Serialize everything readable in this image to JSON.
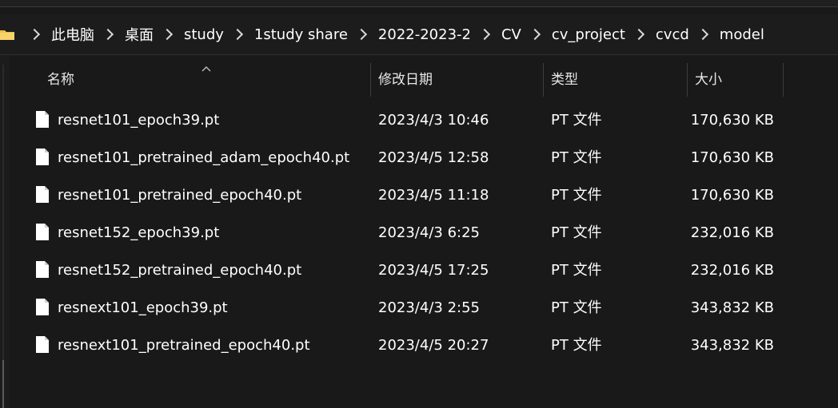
{
  "breadcrumb": {
    "items": [
      "此电脑",
      "桌面",
      "study",
      "1study share",
      "2022-2023-2",
      "CV",
      "cv_project",
      "cvcd",
      "model"
    ]
  },
  "columns": {
    "name": "名称",
    "date": "修改日期",
    "type": "类型",
    "size": "大小"
  },
  "files": [
    {
      "name": "resnet101_epoch39.pt",
      "date": "2023/4/3 10:46",
      "type": "PT 文件",
      "size": "170,630 KB"
    },
    {
      "name": "resnet101_pretrained_adam_epoch40.pt",
      "date": "2023/4/5 12:58",
      "type": "PT 文件",
      "size": "170,630 KB"
    },
    {
      "name": "resnet101_pretrained_epoch40.pt",
      "date": "2023/4/5 11:18",
      "type": "PT 文件",
      "size": "170,630 KB"
    },
    {
      "name": "resnet152_epoch39.pt",
      "date": "2023/4/3 6:25",
      "type": "PT 文件",
      "size": "232,016 KB"
    },
    {
      "name": "resnet152_pretrained_epoch40.pt",
      "date": "2023/4/5 17:25",
      "type": "PT 文件",
      "size": "232,016 KB"
    },
    {
      "name": "resnext101_epoch39.pt",
      "date": "2023/4/3 2:55",
      "type": "PT 文件",
      "size": "343,832 KB"
    },
    {
      "name": "resnext101_pretrained_epoch40.pt",
      "date": "2023/4/5 20:27",
      "type": "PT 文件",
      "size": "343,832 KB"
    }
  ],
  "icons": {
    "folder": "folder-icon",
    "file": "file-icon",
    "separator": "chevron-right-icon",
    "sort": "chevron-up-icon"
  },
  "colors": {
    "background": "#191919",
    "text": "#ffffff",
    "folder": "#f0c14b"
  }
}
